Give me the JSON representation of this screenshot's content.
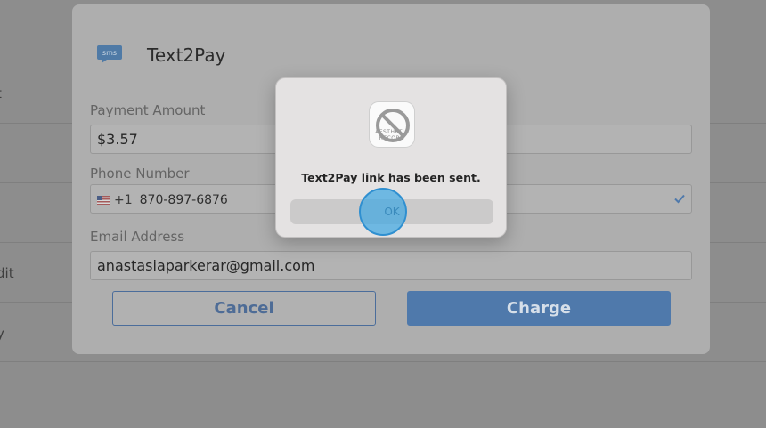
{
  "background": {
    "partial_labels": [
      "t",
      "dit",
      "y"
    ]
  },
  "panel": {
    "title": "Text2Pay",
    "sms_icon_label": "sms",
    "payment_amount_label": "Payment Amount",
    "payment_amount_value": "$3.57",
    "phone_number_label": "Phone Number",
    "phone_country_code": "+1",
    "phone_number_value": "870-897-6876",
    "email_label": "Email Address",
    "email_value": "anastasiaparkerar@gmail.com",
    "cancel_label": "Cancel",
    "charge_label": "Charge"
  },
  "dialog": {
    "app_icon_text": "AESTHETIC RECORD",
    "message": "Text2Pay link has been sent.",
    "ok_label": "OK"
  },
  "colors": {
    "accent": "#4f79ab",
    "click_indicator": "#40a8e2"
  }
}
